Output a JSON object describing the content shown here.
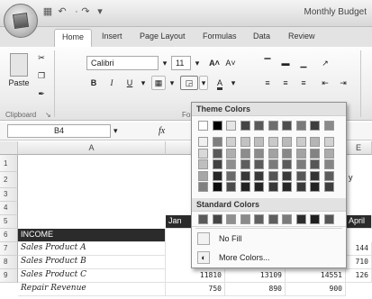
{
  "app": {
    "title": "Monthly Budget"
  },
  "quick_access": {
    "save_icon": "save-icon",
    "undo_icon": "undo-icon",
    "redo_icon": "redo-icon"
  },
  "tabs": [
    "Home",
    "Insert",
    "Page Layout",
    "Formulas",
    "Data",
    "Review"
  ],
  "ribbon": {
    "clipboard": {
      "label": "Clipboard",
      "paste_label": "Paste"
    },
    "font": {
      "label": "Font",
      "font_name": "Calibri",
      "font_size": "11",
      "bold": "B",
      "italic": "I",
      "underline": "U",
      "grow": "A˄",
      "shrink": "A˅",
      "font_color": "A"
    }
  },
  "formula_bar": {
    "name_box": "B4",
    "fx": "fx"
  },
  "sheet": {
    "columns": [
      "A",
      "E"
    ],
    "rows": [
      "1",
      "2",
      "3",
      "4",
      "5",
      "6",
      "7",
      "8",
      "9"
    ],
    "row4": {
      "jan": "Jan",
      "april": "April"
    },
    "income_label": "INCOME",
    "partial_text": "y",
    "items": [
      {
        "label": "Sales Product A",
        "e": "144"
      },
      {
        "label": "Sales Product B",
        "e": "710"
      },
      {
        "label": "Sales Product C",
        "b": "11810",
        "c": "13109",
        "d": "14551",
        "e": "126"
      },
      {
        "label": "Repair Revenue",
        "b": "750",
        "c": "890",
        "d": "900",
        "e": ""
      }
    ]
  },
  "color_menu": {
    "theme_header": "Theme Colors",
    "standard_header": "Standard Colors",
    "no_fill": "No Fill",
    "more_colors": "More Colors...",
    "theme_top": [
      "#ffffff",
      "#000000",
      "#e6e6e6",
      "#444444",
      "#5a5a5a",
      "#6e6e6e",
      "#4d4d4d",
      "#7a7a7a",
      "#3d3d3d",
      "#8a8a8a"
    ],
    "theme_shades": [
      [
        "#f0f0f0",
        "#7f7f7f",
        "#d0d0d0",
        "#c2c2c2",
        "#bdbdbd",
        "#c9c9c9",
        "#bababa",
        "#cbcbcb",
        "#b5b5b5",
        "#d2d2d2"
      ],
      [
        "#d9d9d9",
        "#595959",
        "#aeaeae",
        "#8c8c8c",
        "#8a8a8a",
        "#a2a2a2",
        "#888888",
        "#a3a3a3",
        "#828282",
        "#ababab"
      ],
      [
        "#bfbfbf",
        "#404040",
        "#8e8e8e",
        "#5e5e5e",
        "#5a5a5a",
        "#7b7b7b",
        "#5a5a5a",
        "#7c7c7c",
        "#575757",
        "#858585"
      ],
      [
        "#a6a6a6",
        "#262626",
        "#6a6a6a",
        "#383838",
        "#383838",
        "#555555",
        "#3a3a3a",
        "#575757",
        "#343434",
        "#5c5c5c"
      ],
      [
        "#808080",
        "#0d0d0d",
        "#4a4a4a",
        "#222222",
        "#242424",
        "#383838",
        "#252525",
        "#393939",
        "#222222",
        "#3e3e3e"
      ]
    ],
    "standard": [
      "#5a5a5a",
      "#454545",
      "#8f8f8f",
      "#8a8a8a",
      "#606060",
      "#5e5e5e",
      "#7a7a7a",
      "#2d2d2d",
      "#1e1e1e",
      "#555555"
    ]
  }
}
